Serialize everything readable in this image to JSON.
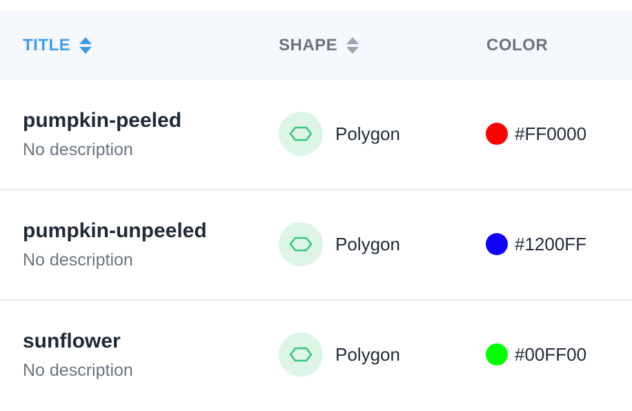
{
  "header": {
    "title": "TITLE",
    "shape": "SHAPE",
    "color": "COLOR"
  },
  "rows": [
    {
      "name": "pumpkin-peeled",
      "description": "No description",
      "shape": "Polygon",
      "color_label": "#FF0000",
      "color_value": "#FF0000"
    },
    {
      "name": "pumpkin-unpeeled",
      "description": "No description",
      "shape": "Polygon",
      "color_label": "#1200FF",
      "color_value": "#1200FF"
    },
    {
      "name": "sunflower",
      "description": "No description",
      "shape": "Polygon",
      "color_label": "#00FF00",
      "color_value": "#00FF00"
    }
  ],
  "colors": {
    "active_header": "#3D9CEA",
    "shape_icon": "#3CC47C",
    "shape_badge_bg": "#DCF5E7"
  },
  "icons": {
    "sort": "sort-icon",
    "shape": "polygon-icon"
  }
}
